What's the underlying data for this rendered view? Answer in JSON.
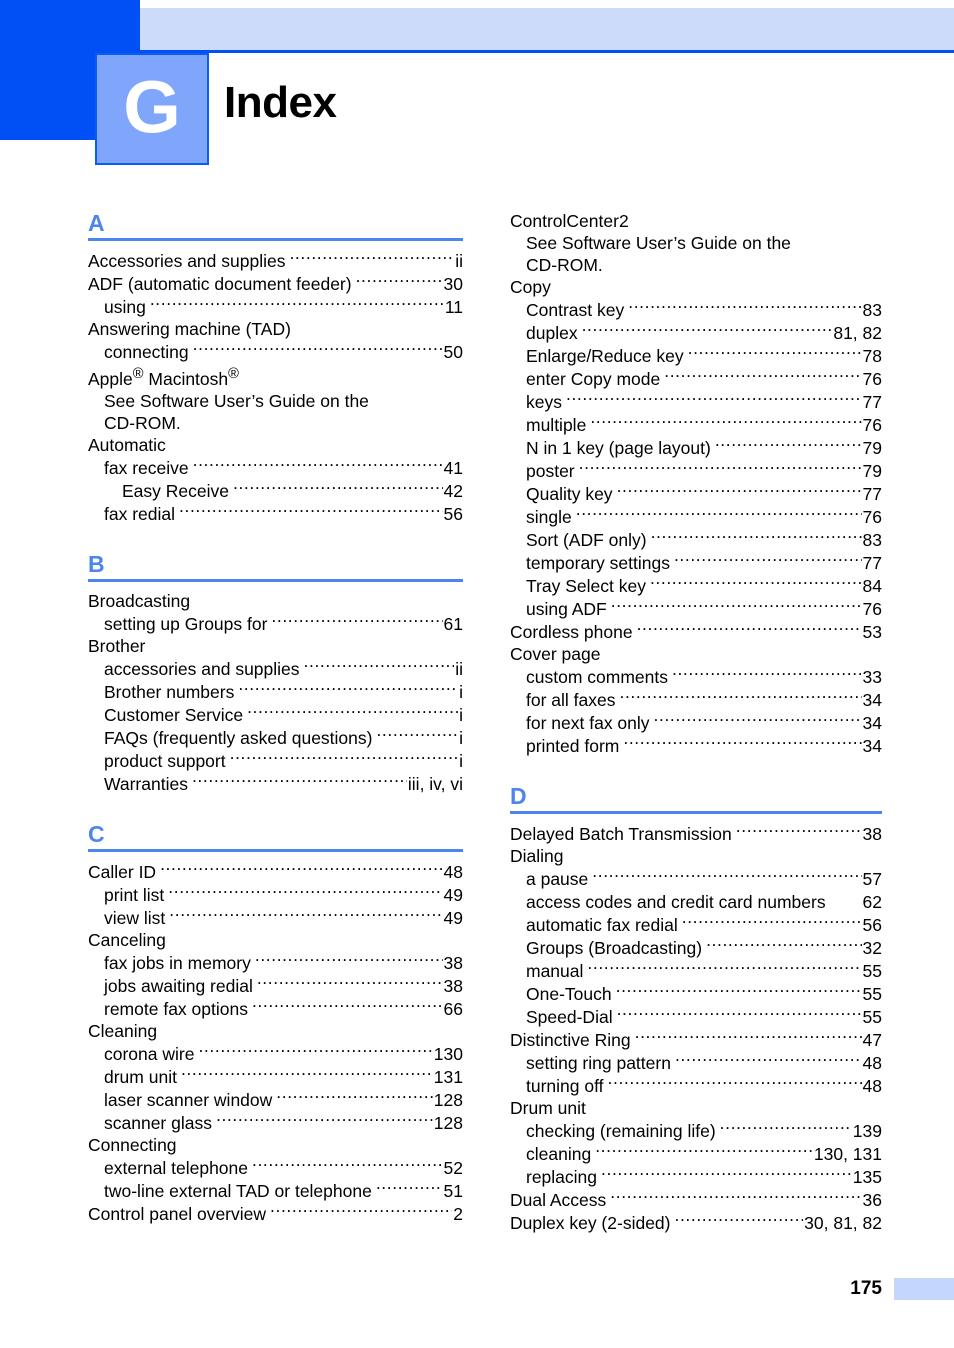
{
  "chapter": {
    "letter": "G",
    "title": "Index"
  },
  "footer": {
    "page_number": "175"
  },
  "colors": {
    "dark_blue": "#0050f5",
    "mid_blue": "#4d85ef",
    "badge_blue": "#7fa6fb",
    "light_blue": "#ccdbfa",
    "footer_bar": "#c4d6fb"
  },
  "columns": {
    "left": [
      {
        "letter": "A",
        "entries": [
          {
            "level": 1,
            "text": "Accessories and supplies",
            "page": "ii"
          },
          {
            "level": 1,
            "text": "ADF (automatic document feeder)",
            "page": "30"
          },
          {
            "level": 2,
            "text": "using",
            "page": "11"
          },
          {
            "level": 1,
            "text": "Answering machine (TAD)",
            "page": "",
            "note": true
          },
          {
            "level": 2,
            "text": "connecting",
            "page": "50"
          },
          {
            "level": 1,
            "text": "Apple® Macintosh®",
            "page": "",
            "note": true,
            "html": "Apple<sup>®</sup> Macintosh<sup>®</sup>"
          },
          {
            "level": 2,
            "text": "See Software User’s Guide on the",
            "page": "",
            "note": true
          },
          {
            "level": 2,
            "text": "CD-ROM.",
            "page": "",
            "note": true
          },
          {
            "level": 1,
            "text": "Automatic",
            "page": "",
            "note": true
          },
          {
            "level": 2,
            "text": "fax receive",
            "page": "41"
          },
          {
            "level": 3,
            "text": "Easy Receive",
            "page": "42"
          },
          {
            "level": 2,
            "text": "fax redial",
            "page": "56"
          }
        ]
      },
      {
        "letter": "B",
        "entries": [
          {
            "level": 1,
            "text": "Broadcasting",
            "page": "",
            "note": true
          },
          {
            "level": 2,
            "text": "setting up Groups for",
            "page": "61"
          },
          {
            "level": 1,
            "text": "Brother",
            "page": "",
            "note": true
          },
          {
            "level": 2,
            "text": "accessories and supplies",
            "page": "ii"
          },
          {
            "level": 2,
            "text": "Brother numbers",
            "page": "i"
          },
          {
            "level": 2,
            "text": "Customer Service",
            "page": "i"
          },
          {
            "level": 2,
            "text": "FAQs (frequently asked questions)",
            "page": "i"
          },
          {
            "level": 2,
            "text": "product support",
            "page": "i"
          },
          {
            "level": 2,
            "text": "Warranties",
            "page": "iii, iv, vi"
          }
        ]
      },
      {
        "letter": "C",
        "entries": [
          {
            "level": 1,
            "text": "Caller ID",
            "page": "48"
          },
          {
            "level": 2,
            "text": "print list",
            "page": "49"
          },
          {
            "level": 2,
            "text": "view list",
            "page": "49"
          },
          {
            "level": 1,
            "text": "Canceling",
            "page": "",
            "note": true
          },
          {
            "level": 2,
            "text": "fax jobs in memory",
            "page": "38"
          },
          {
            "level": 2,
            "text": "jobs awaiting redial",
            "page": "38"
          },
          {
            "level": 2,
            "text": "remote fax options",
            "page": "66"
          },
          {
            "level": 1,
            "text": "Cleaning",
            "page": "",
            "note": true
          },
          {
            "level": 2,
            "text": "corona wire",
            "page": "130"
          },
          {
            "level": 2,
            "text": "drum unit",
            "page": "131"
          },
          {
            "level": 2,
            "text": "laser scanner window",
            "page": "128"
          },
          {
            "level": 2,
            "text": "scanner glass",
            "page": "128"
          },
          {
            "level": 1,
            "text": "Connecting",
            "page": "",
            "note": true
          },
          {
            "level": 2,
            "text": "external telephone",
            "page": "52"
          },
          {
            "level": 2,
            "text": "two-line external TAD or telephone",
            "page": "51"
          },
          {
            "level": 1,
            "text": "Control panel overview",
            "page": "2"
          }
        ]
      }
    ],
    "right": [
      {
        "letter": "",
        "entries": [
          {
            "level": 1,
            "text": "ControlCenter2",
            "page": "",
            "note": true
          },
          {
            "level": 2,
            "text": "See Software User’s Guide on the",
            "page": "",
            "note": true
          },
          {
            "level": 2,
            "text": "CD-ROM.",
            "page": "",
            "note": true
          },
          {
            "level": 1,
            "text": "Copy",
            "page": "",
            "note": true
          },
          {
            "level": 2,
            "text": "Contrast key",
            "page": "83"
          },
          {
            "level": 2,
            "text": "duplex",
            "page": "81, 82"
          },
          {
            "level": 2,
            "text": "Enlarge/Reduce key",
            "page": "78"
          },
          {
            "level": 2,
            "text": "enter Copy mode",
            "page": "76"
          },
          {
            "level": 2,
            "text": "keys",
            "page": "77"
          },
          {
            "level": 2,
            "text": "multiple",
            "page": "76"
          },
          {
            "level": 2,
            "text": "N in 1 key (page layout)",
            "page": "79"
          },
          {
            "level": 2,
            "text": "poster",
            "page": "79"
          },
          {
            "level": 2,
            "text": "Quality key",
            "page": "77"
          },
          {
            "level": 2,
            "text": "single",
            "page": "76"
          },
          {
            "level": 2,
            "text": "Sort (ADF only)",
            "page": "83"
          },
          {
            "level": 2,
            "text": "temporary settings",
            "page": "77"
          },
          {
            "level": 2,
            "text": "Tray Select key",
            "page": "84"
          },
          {
            "level": 2,
            "text": "using ADF",
            "page": "76"
          },
          {
            "level": 1,
            "text": "Cordless phone",
            "page": "53"
          },
          {
            "level": 1,
            "text": "Cover page",
            "page": "",
            "note": true
          },
          {
            "level": 2,
            "text": "custom comments",
            "page": "33"
          },
          {
            "level": 2,
            "text": "for all faxes",
            "page": "34"
          },
          {
            "level": 2,
            "text": "for next fax only",
            "page": "34"
          },
          {
            "level": 2,
            "text": "printed form",
            "page": "34"
          }
        ]
      },
      {
        "letter": "D",
        "entries": [
          {
            "level": 1,
            "text": "Delayed Batch Transmission",
            "page": "38"
          },
          {
            "level": 1,
            "text": "Dialing",
            "page": "",
            "note": true
          },
          {
            "level": 2,
            "text": "a pause",
            "page": "57"
          },
          {
            "level": 2,
            "text": "access codes and credit card numbers",
            "page": "62",
            "nodots": true
          },
          {
            "level": 2,
            "text": "automatic fax redial",
            "page": "56"
          },
          {
            "level": 2,
            "text": "Groups (Broadcasting)",
            "page": "32"
          },
          {
            "level": 2,
            "text": "manual",
            "page": "55"
          },
          {
            "level": 2,
            "text": "One-Touch",
            "page": "55"
          },
          {
            "level": 2,
            "text": "Speed-Dial",
            "page": "55"
          },
          {
            "level": 1,
            "text": "Distinctive Ring",
            "page": "47"
          },
          {
            "level": 2,
            "text": "setting ring pattern",
            "page": "48"
          },
          {
            "level": 2,
            "text": "turning off",
            "page": "48"
          },
          {
            "level": 1,
            "text": "Drum unit",
            "page": "",
            "note": true
          },
          {
            "level": 2,
            "text": "checking (remaining life)",
            "page": "139"
          },
          {
            "level": 2,
            "text": "cleaning",
            "page": "130, 131"
          },
          {
            "level": 2,
            "text": "replacing",
            "page": "135"
          },
          {
            "level": 1,
            "text": "Dual Access",
            "page": "36"
          },
          {
            "level": 1,
            "text": "Duplex key (2-sided)",
            "page": "30, 81, 82"
          }
        ]
      }
    ]
  }
}
